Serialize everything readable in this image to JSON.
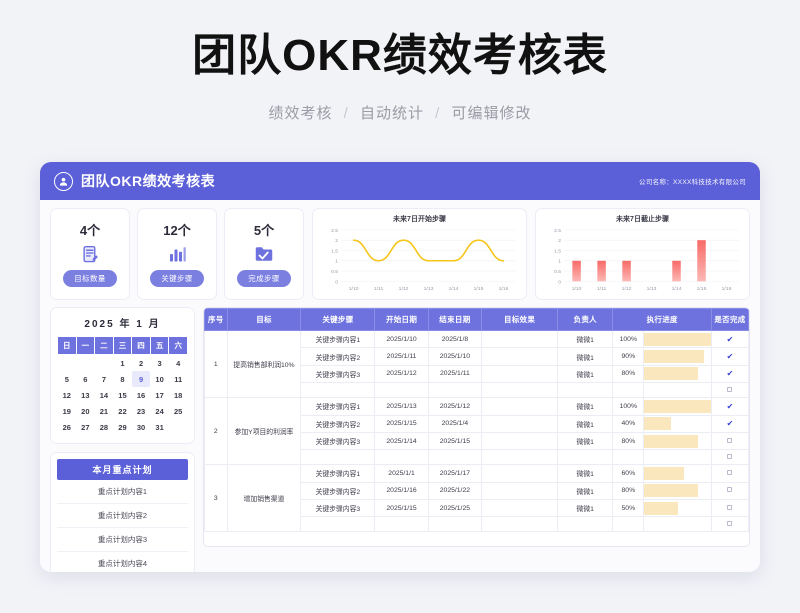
{
  "poster": {
    "title": "团队OKR绩效考核表",
    "subtitle_parts": [
      "绩效考核",
      "自动统计",
      "可编辑修改"
    ],
    "separator": "/"
  },
  "app": {
    "header": {
      "icon": "user-circle-icon",
      "title": "团队OKR绩效考核表",
      "company_label": "公司名称：",
      "company_name": "XXXX科技技术有限公司",
      "accent_color": "#5b5fd8"
    },
    "stat_cards": [
      {
        "value": "4个",
        "label": "目标数量",
        "icon": "document-edit-icon"
      },
      {
        "value": "12个",
        "label": "关键步骤",
        "icon": "bar-chart-icon"
      },
      {
        "value": "5个",
        "label": "完成步骤",
        "icon": "folder-check-icon"
      }
    ],
    "calendar": {
      "year": "2025",
      "year_unit": "年",
      "month": "1",
      "month_unit": "月",
      "weekdays": [
        "日",
        "一",
        "二",
        "三",
        "四",
        "五",
        "六"
      ],
      "weeks": [
        [
          "",
          "",
          "",
          "1",
          "2",
          "3",
          "4"
        ],
        [
          "5",
          "6",
          "7",
          "8",
          "9",
          "10",
          "11"
        ],
        [
          "12",
          "13",
          "14",
          "15",
          "16",
          "17",
          "18"
        ],
        [
          "19",
          "20",
          "21",
          "22",
          "23",
          "24",
          "25"
        ],
        [
          "26",
          "27",
          "28",
          "29",
          "30",
          "31",
          ""
        ]
      ],
      "today": "9"
    },
    "plan_panel": {
      "title": "本月重点计划",
      "items": [
        "重点计划内容1",
        "重点计划内容2",
        "重点计划内容3",
        "重点计划内容4"
      ]
    },
    "table": {
      "headers": [
        "序号",
        "目标",
        "关键步骤",
        "开始日期",
        "结束日期",
        "目标效果",
        "负责人",
        "执行进度",
        "是否完成"
      ],
      "groups": [
        {
          "seq": "1",
          "goal": "提高销售部利润10%",
          "rows": [
            {
              "step": "关键步骤内容1",
              "start": "2025/1/10",
              "end": "2025/1/8",
              "effect": "",
              "owner": "微微1",
              "progress": "100%",
              "progress_value": 100,
              "done": true
            },
            {
              "step": "关键步骤内容2",
              "start": "2025/1/11",
              "end": "2025/1/10",
              "effect": "",
              "owner": "微微1",
              "progress": "90%",
              "progress_value": 90,
              "done": true
            },
            {
              "step": "关键步骤内容3",
              "start": "2025/1/12",
              "end": "2025/1/11",
              "effect": "",
              "owner": "微微1",
              "progress": "80%",
              "progress_value": 80,
              "done": true
            },
            {
              "step": "",
              "start": "",
              "end": "",
              "effect": "",
              "owner": "",
              "progress": "",
              "progress_value": 0,
              "done": false
            }
          ]
        },
        {
          "seq": "2",
          "goal": "参加Y项目的利润率",
          "rows": [
            {
              "step": "关键步骤内容1",
              "start": "2025/1/13",
              "end": "2025/1/12",
              "effect": "",
              "owner": "微微1",
              "progress": "100%",
              "progress_value": 100,
              "done": true
            },
            {
              "step": "关键步骤内容2",
              "start": "2025/1/15",
              "end": "2025/1/4",
              "effect": "",
              "owner": "微微1",
              "progress": "40%",
              "progress_value": 40,
              "done": true
            },
            {
              "step": "关键步骤内容3",
              "start": "2025/1/14",
              "end": "2025/1/15",
              "effect": "",
              "owner": "微微1",
              "progress": "80%",
              "progress_value": 80,
              "done": false
            },
            {
              "step": "",
              "start": "",
              "end": "",
              "effect": "",
              "owner": "",
              "progress": "",
              "progress_value": 0,
              "done": false
            }
          ]
        },
        {
          "seq": "3",
          "goal": "增加销售渠道",
          "rows": [
            {
              "step": "关键步骤内容1",
              "start": "2025/1/1",
              "end": "2025/1/17",
              "effect": "",
              "owner": "微微1",
              "progress": "60%",
              "progress_value": 60,
              "done": false
            },
            {
              "step": "关键步骤内容2",
              "start": "2025/1/16",
              "end": "2025/1/22",
              "effect": "",
              "owner": "微微1",
              "progress": "80%",
              "progress_value": 80,
              "done": false
            },
            {
              "step": "关键步骤内容3",
              "start": "2025/1/15",
              "end": "2025/1/25",
              "effect": "",
              "owner": "微微1",
              "progress": "50%",
              "progress_value": 50,
              "done": false
            },
            {
              "step": "",
              "start": "",
              "end": "",
              "effect": "",
              "owner": "",
              "progress": "",
              "progress_value": 0,
              "done": false
            }
          ]
        }
      ]
    }
  },
  "chart_data": [
    {
      "type": "line",
      "title": "未来7日开始步骤",
      "categories": [
        "1/10",
        "1/11",
        "1/12",
        "1/13",
        "1/14",
        "1/15",
        "1/16"
      ],
      "values": [
        2,
        1,
        2,
        1,
        1,
        2,
        1
      ],
      "yticks": [
        "0",
        "0.5",
        "1",
        "1.5",
        "2",
        "2.5"
      ],
      "ylim": [
        0,
        2.5
      ],
      "xlabel": "",
      "ylabel": "",
      "grid": true,
      "legend": "none",
      "color": "#f5c518"
    },
    {
      "type": "bar",
      "title": "未来7日截止步骤",
      "categories": [
        "1/10",
        "1/11",
        "1/12",
        "1/13",
        "1/14",
        "1/15",
        "1/16"
      ],
      "values": [
        1,
        1,
        1,
        0,
        1,
        2,
        0
      ],
      "yticks": [
        "0",
        "0.5",
        "1",
        "1.5",
        "2",
        "2.5"
      ],
      "ylim": [
        0,
        2.5
      ],
      "xlabel": "",
      "ylabel": "",
      "grid": true,
      "legend": "none",
      "color": "#f8837f"
    }
  ]
}
